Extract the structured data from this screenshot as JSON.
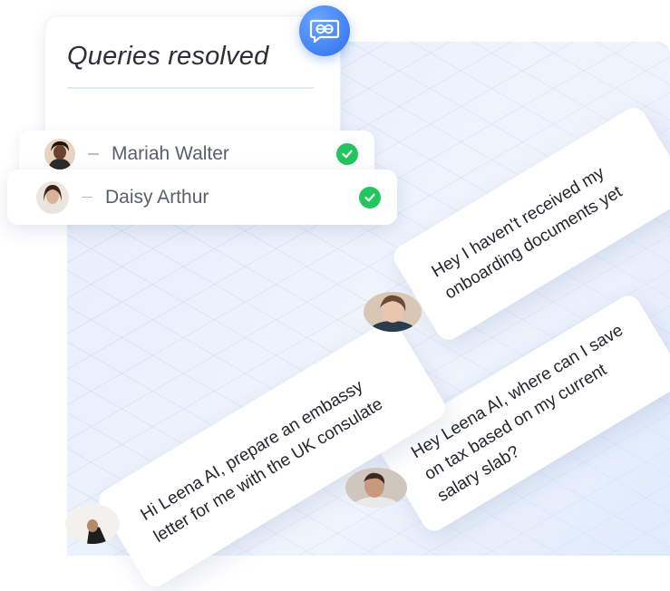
{
  "queries_card": {
    "title": "Queries resolved"
  },
  "resolved": [
    {
      "name": "Mariah Walter",
      "status": "resolved"
    },
    {
      "name": "Daisy Arthur",
      "status": "resolved"
    }
  ],
  "chats": [
    {
      "text": "Hey I haven't received my onboarding documents yet"
    },
    {
      "text": "Hey Leena AI, where can I save on tax based on my current salary slab?"
    },
    {
      "text": "Hi Leena AI, prepare an embassy letter for me with the UK consulate"
    }
  ],
  "colors": {
    "brand": "#2f6ef0",
    "check": "#22c55e",
    "grid_bg": "#e7eefb"
  },
  "icons": {
    "brand": "leena-ai-logo-icon",
    "check": "check-circle-icon"
  }
}
